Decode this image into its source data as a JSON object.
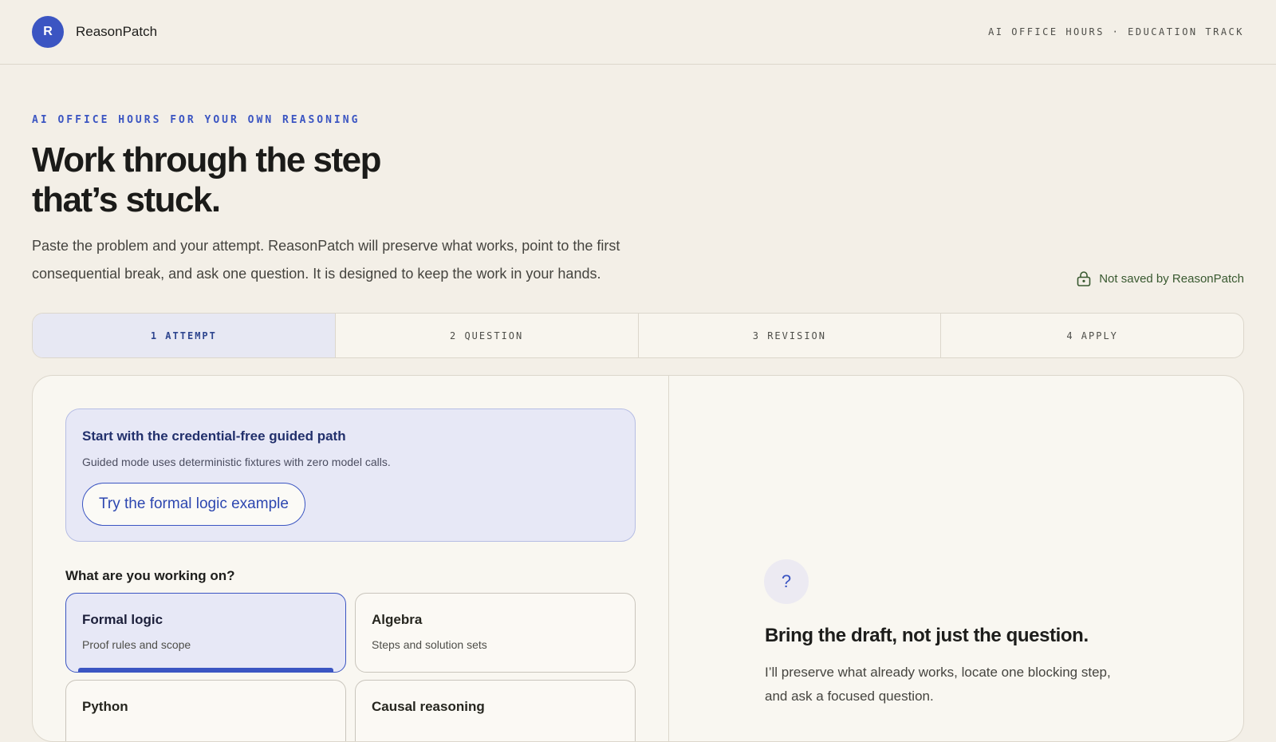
{
  "header": {
    "brand_initial": "R",
    "brand_name": "ReasonPatch",
    "track_label": "AI OFFICE HOURS · EDUCATION TRACK"
  },
  "hero": {
    "eyebrow": "AI OFFICE HOURS FOR YOUR OWN REASONING",
    "headline_line1": "Work through the step",
    "headline_line2": "that’s stuck.",
    "intro": "Paste the problem and your attempt. ReasonPatch will preserve what works, point to the first consequential break, and ask one question. It is designed to keep the work in your hands.",
    "privacy_note": "Not saved by ReasonPatch"
  },
  "steps": [
    {
      "label": "1 ATTEMPT",
      "active": true
    },
    {
      "label": "2 QUESTION",
      "active": false
    },
    {
      "label": "3 REVISION",
      "active": false
    },
    {
      "label": "4 APPLY",
      "active": false
    }
  ],
  "guided": {
    "title": "Start with the credential-free guided path",
    "subtitle": "Guided mode uses deterministic fixtures with zero model calls.",
    "button_label": "Try the formal logic example"
  },
  "topics": {
    "label": "What are you working on?",
    "items": [
      {
        "name": "Formal logic",
        "desc": "Proof rules and scope",
        "selected": true
      },
      {
        "name": "Algebra",
        "desc": "Steps and solution sets",
        "selected": false
      },
      {
        "name": "Python",
        "desc": "",
        "selected": false
      },
      {
        "name": "Causal reasoning",
        "desc": "",
        "selected": false
      }
    ]
  },
  "right_pane": {
    "badge": "?",
    "title": "Bring the draft, not just the question.",
    "body_line1": "I’ll preserve what already works, locate one blocking step,",
    "body_line2": "and ask a focused question."
  },
  "colors": {
    "accent": "#3b55c2",
    "background": "#f3efe7",
    "privacy_green": "#38582f"
  }
}
